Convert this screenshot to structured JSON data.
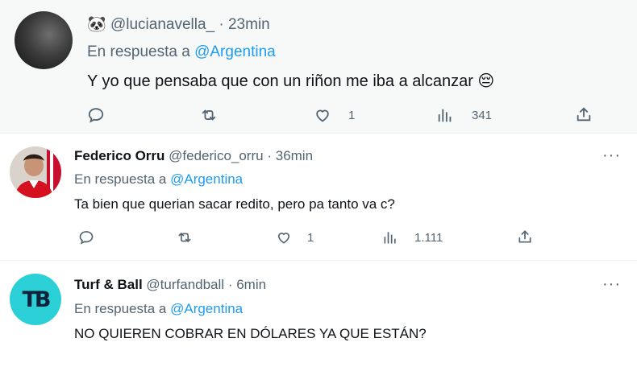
{
  "tweets": [
    {
      "emoji": "🐼",
      "handle": "@lucianavella_",
      "sep": "·",
      "time": "23min",
      "reply_prefix": "En respuesta a",
      "reply_to": "@Argentina",
      "text": "Y yo que pensaba que con un riñon me iba a alcanzar",
      "text_emoji": "😔",
      "likes": "1",
      "views": "341"
    },
    {
      "name": "Federico Orru",
      "handle": "@federico_orru",
      "sep": "·",
      "time": "36min",
      "reply_prefix": "En respuesta a",
      "reply_to": "@Argentina",
      "text": "Ta bien que querian sacar redito, pero pa tanto va c?",
      "likes": "1",
      "views": "1.111",
      "more": "···"
    },
    {
      "name": "Turf & Ball",
      "handle": "@turfandball",
      "sep": "·",
      "time": "6min",
      "reply_prefix": "En respuesta a",
      "reply_to": "@Argentina",
      "text": "NO QUIEREN COBRAR EN DÓLARES YA QUE ESTÁN?",
      "avatar_text": "TB",
      "more": "···"
    }
  ],
  "icons": [
    "reply-icon",
    "retweet-icon",
    "like-icon",
    "views-icon",
    "share-icon"
  ],
  "colors": {
    "link": "#1d9bf0",
    "muted": "#536471",
    "text": "#0f1419",
    "avatar_turf": "#20cdd8"
  }
}
